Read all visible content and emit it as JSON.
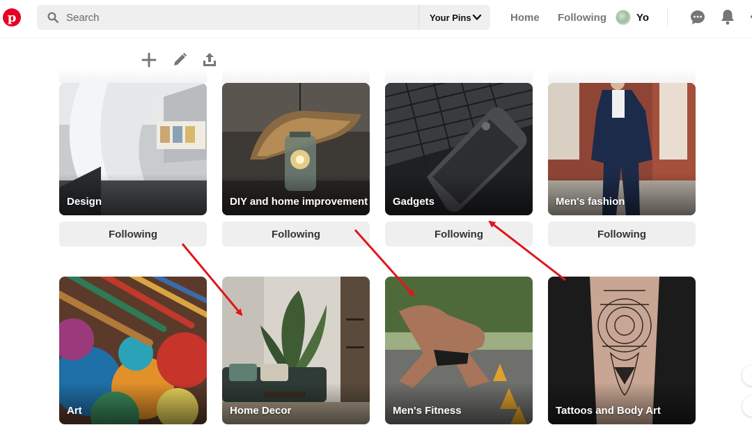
{
  "header": {
    "logo_letter": "p",
    "search_placeholder": "Search",
    "search_scope": "Your Pins",
    "nav": {
      "home": "Home",
      "following": "Following"
    },
    "profile_name": "Yo"
  },
  "toolbar": {
    "icons": [
      "plus-icon",
      "pencil-icon",
      "share-icon"
    ]
  },
  "boards_following": [
    {
      "name": "Design",
      "button_label": "Following"
    },
    {
      "name": "DIY and home improvement",
      "button_label": "Following"
    },
    {
      "name": "Gadgets",
      "button_label": "Following"
    },
    {
      "name": "Men's fashion",
      "button_label": "Following"
    }
  ],
  "boards_suggested": [
    {
      "name": "Art"
    },
    {
      "name": "Home Decor"
    },
    {
      "name": "Men's Fitness"
    },
    {
      "name": "Tattoos and Body Art"
    }
  ],
  "colors": {
    "brand": "#e60023",
    "annotation_arrow": "#e0161b",
    "button_bg": "#efefef",
    "nav_text": "#767676"
  }
}
